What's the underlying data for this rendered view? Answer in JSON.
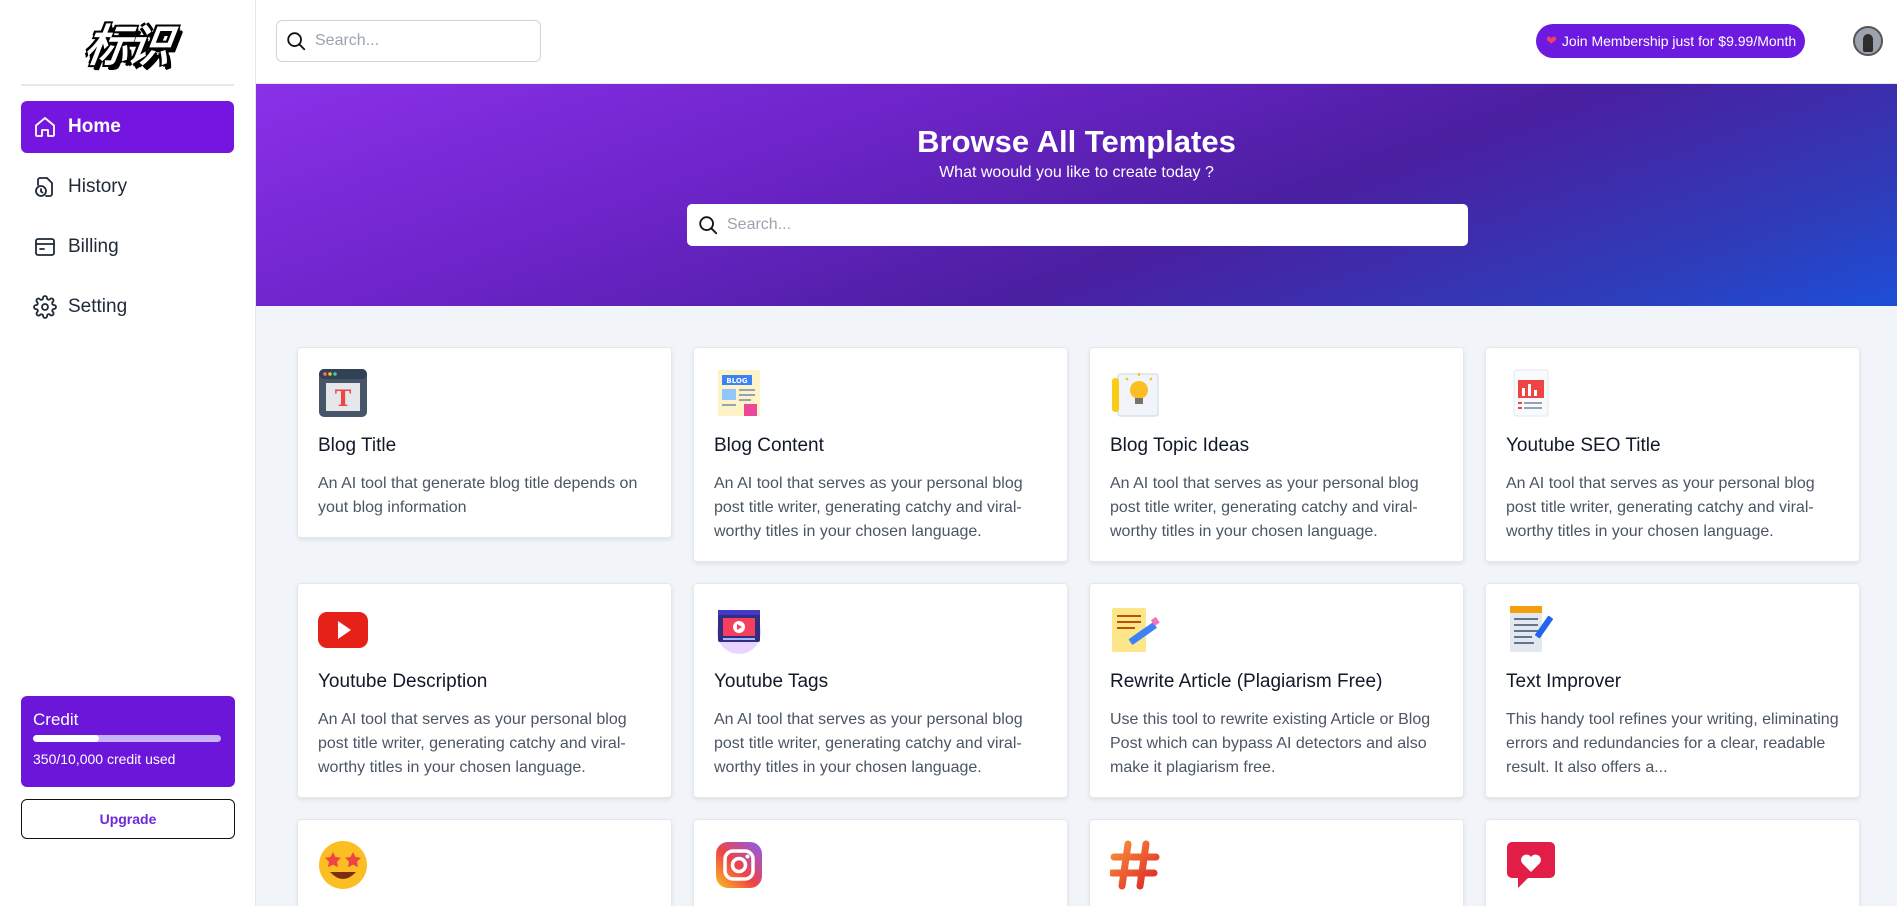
{
  "sidebar": {
    "logo": "标识",
    "items": [
      {
        "label": "Home",
        "icon": "home-icon"
      },
      {
        "label": "History",
        "icon": "history-icon"
      },
      {
        "label": "Billing",
        "icon": "billing-icon"
      },
      {
        "label": "Setting",
        "icon": "gear-icon"
      }
    ],
    "credit": {
      "title": "Credit",
      "used_text": "350/10,000 credit used",
      "used_fraction": 0.35
    },
    "upgrade_label": "Upgrade"
  },
  "header": {
    "search_placeholder": "Search...",
    "membership_label": "Join Membership just for $9.99/Month"
  },
  "hero": {
    "title": "Browse All Templates",
    "subtitle": "What woould you like to create today ?",
    "search_placeholder": "Search..."
  },
  "templates": [
    {
      "title": "Blog Title",
      "desc": "An AI tool that generate blog title depends on yout blog information",
      "icon": "blog-title-icon"
    },
    {
      "title": "Blog Content",
      "desc": "An AI tool that serves as your personal blog post title writer, generating catchy and viral-worthy titles in your chosen language.",
      "icon": "blog-content-icon"
    },
    {
      "title": "Blog Topic Ideas",
      "desc": "An AI tool that serves as your personal blog post title writer, generating catchy and viral-worthy titles in your chosen language.",
      "icon": "lightbulb-icon"
    },
    {
      "title": "Youtube SEO Title",
      "desc": "An AI tool that serves as your personal blog post title writer, generating catchy and viral-worthy titles in your chosen language.",
      "icon": "seo-report-icon"
    },
    {
      "title": "Youtube Description",
      "desc": "An AI tool that serves as your personal blog post title writer, generating catchy and viral-worthy titles in your chosen language.",
      "icon": "youtube-icon"
    },
    {
      "title": "Youtube Tags",
      "desc": "An AI tool that serves as your personal blog post title writer, generating catchy and viral-worthy titles in your chosen language.",
      "icon": "video-player-icon"
    },
    {
      "title": "Rewrite Article (Plagiarism Free)",
      "desc": "Use this tool to rewrite existing Article or Blog Post which can bypass AI detectors and also make it plagiarism free.",
      "icon": "pencil-paper-icon"
    },
    {
      "title": "Text Improver",
      "desc": "This handy tool refines your writing, eliminating errors and redundancies for a clear, readable result. It also offers a...",
      "icon": "notepad-icon"
    },
    {
      "title": "",
      "desc": "",
      "icon": "star-struck-emoji-icon"
    },
    {
      "title": "",
      "desc": "",
      "icon": "instagram-icon"
    },
    {
      "title": "",
      "desc": "",
      "icon": "hashtag-icon"
    },
    {
      "title": "",
      "desc": "",
      "icon": "heart-chat-icon"
    }
  ]
}
